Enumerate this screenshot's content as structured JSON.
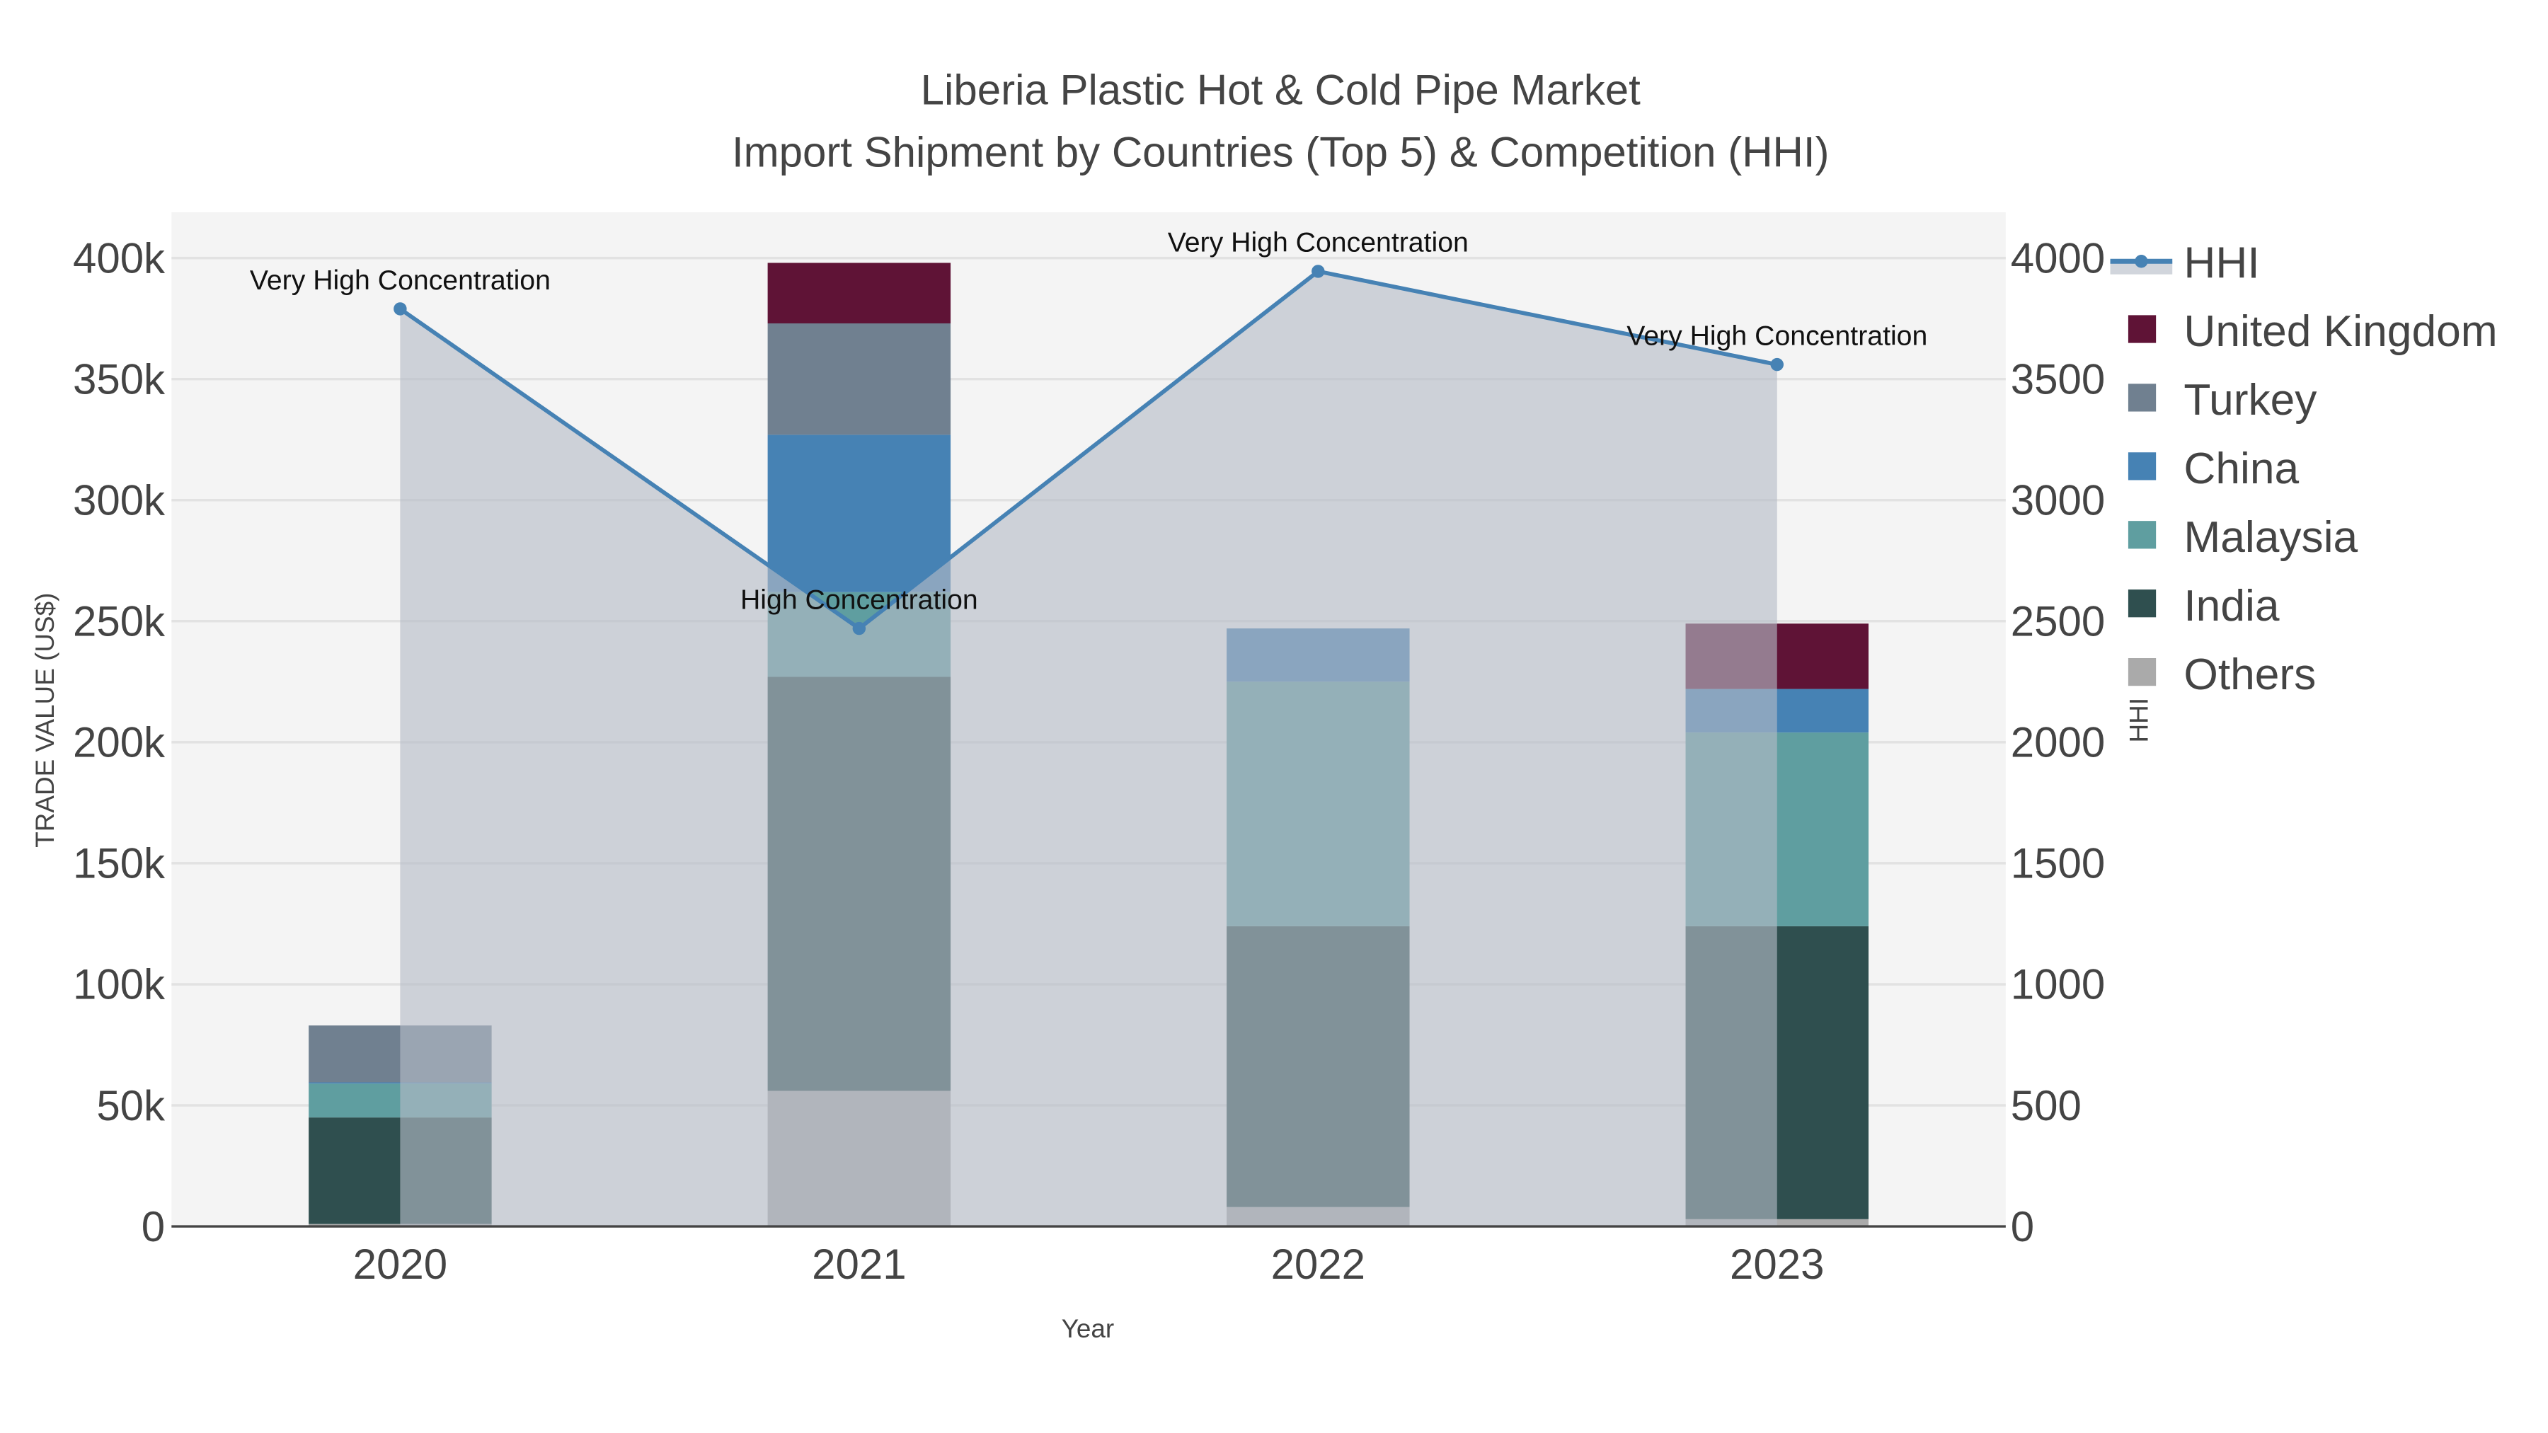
{
  "chart_data": {
    "type": "bar",
    "title": "Liberia Plastic Hot & Cold Pipe Market",
    "subtitle": "Import Shipment by Countries (Top 5) & Competition (HHI)",
    "xlabel": "Year",
    "ylabel": "TRADE VALUE (US$)",
    "y2label": "HHI",
    "ylim": [
      0,
      420000
    ],
    "y2lim": [
      0,
      4200
    ],
    "yticks": [
      0,
      50000,
      100000,
      150000,
      200000,
      250000,
      300000,
      350000,
      400000
    ],
    "ytick_labels": [
      "0",
      "50k",
      "100k",
      "150k",
      "200k",
      "250k",
      "300k",
      "350k",
      "400k"
    ],
    "y2ticks": [
      0,
      500,
      1000,
      1500,
      2000,
      2500,
      3000,
      3500,
      4000
    ],
    "y2tick_labels": [
      "0",
      "500",
      "1000",
      "1500",
      "2000",
      "2500",
      "3000",
      "3500",
      "4000"
    ],
    "categories": [
      "2020",
      "2021",
      "2022",
      "2023"
    ],
    "stacked": true,
    "grid": true,
    "legend_position": "right",
    "series": [
      {
        "name": "Others",
        "color": "#aaaaaa",
        "values": [
          1000,
          56000,
          8000,
          3000
        ]
      },
      {
        "name": "India",
        "color": "#2f4f4f",
        "values": [
          44000,
          171000,
          116000,
          121000
        ]
      },
      {
        "name": "Malaysia",
        "color": "#5f9ea0",
        "values": [
          14000,
          35000,
          101000,
          80000
        ]
      },
      {
        "name": "China",
        "color": "#4682b4",
        "values": [
          500,
          65000,
          22000,
          18000
        ]
      },
      {
        "name": "Turkey",
        "color": "#708090",
        "values": [
          23500,
          46000,
          0,
          0
        ]
      },
      {
        "name": "United Kingdom",
        "color": "#5f1336",
        "values": [
          0,
          25000,
          0,
          27000
        ]
      }
    ],
    "hhi": {
      "name": "HHI",
      "color": "#4682b4",
      "values": [
        3790,
        2470,
        3945,
        3560
      ],
      "annotations": [
        "Very High Concentration",
        "High Concentration",
        "Very High Concentration",
        "Very High Concentration"
      ]
    },
    "legend_order": [
      "HHI",
      "United Kingdom",
      "Turkey",
      "China",
      "Malaysia",
      "India",
      "Others"
    ]
  }
}
